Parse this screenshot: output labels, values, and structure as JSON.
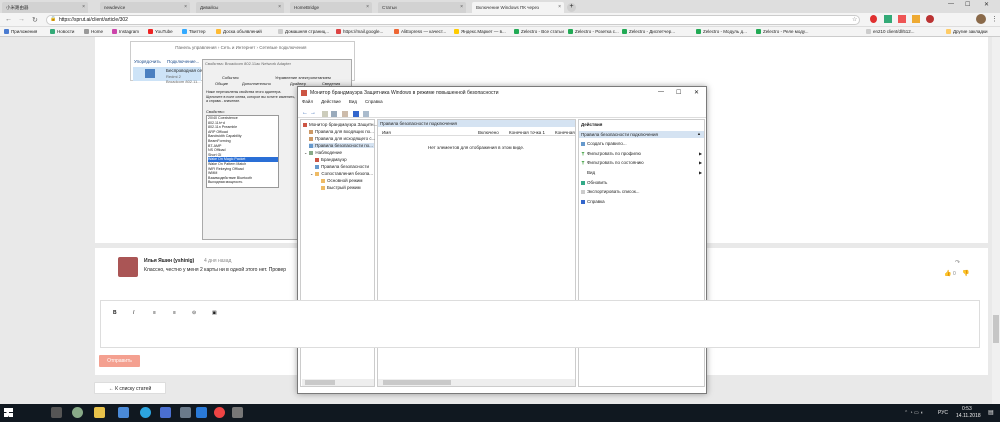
{
  "browser": {
    "tabs": [
      {
        "label": "小米路由器",
        "active": false
      },
      {
        "label": "newdevice",
        "active": false
      },
      {
        "label": "Дивайсы",
        "active": false
      },
      {
        "label": "HomeBridge",
        "active": false
      },
      {
        "label": "Статьи",
        "active": false
      },
      {
        "label": "Включение Windows ПК через",
        "active": true
      }
    ],
    "new_tab": "+",
    "address": "https://sprut.ai/client/article/302",
    "bookmarks": [
      "Приложения",
      "Новости",
      "Home",
      "Instagram",
      "YouTube",
      "Твиттер",
      "Доска объявлений",
      "Домашняя страниц...",
      "https://mail.google...",
      "AliExpress — качест...",
      "Яндекс.Маркет — в...",
      "Zelectro - Все статьи",
      "Zelectro - Розетка с...",
      "Zelectro - Диспетчер...",
      "Zelectro - Модуль д...",
      "Zelectro - Реле моду...",
      "en210 client/dl/512...",
      "Другие закладки"
    ]
  },
  "explorer": {
    "breadcrumb": [
      "Панель управления",
      "Сеть и Интернет",
      "Сетевые подключения"
    ],
    "toolbar": [
      "Упорядочить",
      "Подключение..."
    ],
    "adapter_name": "Беспроводная сеть",
    "adapter_sub": "Redmi 2",
    "adapter_sub2": "Broadcom 802.11..."
  },
  "props": {
    "title": "Свойства: Broadcom 802.11ac Network Adapter",
    "tabs_row1": [
      "События",
      "Управление электропитанием"
    ],
    "tabs_row2": [
      "Общие",
      "Дополнительно",
      "Драйвер",
      "Сведения"
    ],
    "desc": "Ниже перечислены свойства этого адаптера. Щелкните в поле слева, которое вы хотите изменить, а справа - значение.",
    "list_label": "Свойство:",
    "items": [
      "20/40 Coexistence",
      "802.11h+d",
      "802.11n Preamble",
      "ARP Offload",
      "Bandwidth Capability",
      "BeamForming",
      "BT-AMP",
      "NS Offload",
      "Short GI",
      "Wake On Magic Packet",
      "Wake On Pattern Match",
      "WiFi Rekeying Offload",
      "WMM",
      "Взаимодействие Bluetooth",
      "Выходная мощность"
    ],
    "selected": "Wake On Magic Packet"
  },
  "firewall": {
    "title": "Монитор брандмауэра Защитника Windows в режиме повышенной безопасности",
    "menu": [
      "Файл",
      "Действие",
      "Вид",
      "Справка"
    ],
    "tree": [
      "Монитор брандмауэра Защитн...",
      "Правила для входящих по...",
      "Правила для исходящего с...",
      "Правила безопасности по...",
      "Наблюдение",
      "Брандмауэр",
      "Правила безопасности",
      "Сопоставления безопа...",
      "Основной режим",
      "Быстрый режим"
    ],
    "mid_header": "Правила безопасности подключения",
    "columns": [
      "Имя",
      "Включено",
      "Конечная точка 1",
      "Конечная"
    ],
    "empty": "Нет элементов для отображения в этом виде.",
    "actions_header": "Действия",
    "actions_group": "Правила безопасности подключения",
    "actions": [
      "Создать правило...",
      "Фильтровать по профилю",
      "Фильтровать по состоянию",
      "Вид",
      "Обновить",
      "Экспортировать список...",
      "Справка"
    ]
  },
  "comment": {
    "author": "Илья Яшин (yshinig)",
    "time": "4 дня назад",
    "text": "Классно, честно у меня 2 карты ни в одной этого нет. Провер",
    "likes": "0"
  },
  "editor": {
    "tools": [
      "B",
      "I",
      "≡",
      "≡",
      "⊝",
      "▣"
    ],
    "submit": "Отправить",
    "back": "← К списку статей"
  },
  "taskbar": {
    "lang": "РУС",
    "time": "0:53",
    "date": "14.11.2018"
  }
}
